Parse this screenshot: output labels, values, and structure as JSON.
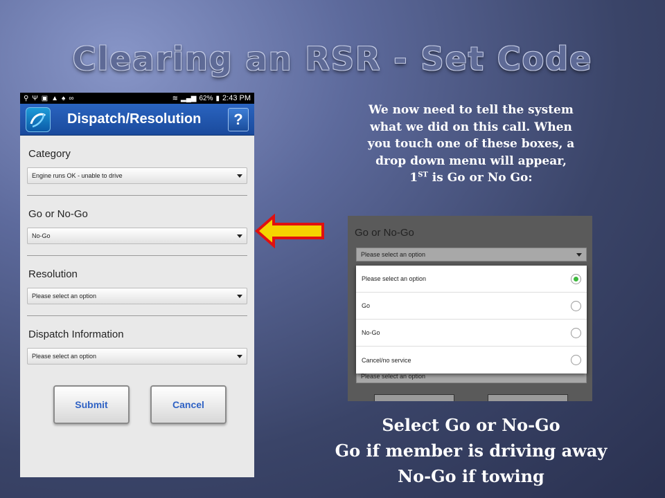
{
  "slide": {
    "title": "Clearing an RSR - Set Code"
  },
  "phone": {
    "status_bar": {
      "battery": "62%",
      "time": "2:43 PM"
    },
    "app_bar": {
      "title": "Dispatch/Resolution",
      "help_label": "?"
    },
    "fields": [
      {
        "label": "Category",
        "value": "Engine runs OK - unable to drive"
      },
      {
        "label": "Go or No-Go",
        "value": "No-Go"
      },
      {
        "label": "Resolution",
        "value": "Please select an option"
      },
      {
        "label": "Dispatch Information",
        "value": "Please select an option"
      }
    ],
    "buttons": {
      "submit": "Submit",
      "cancel": "Cancel"
    }
  },
  "instructions": {
    "line1": "We now need to tell the system",
    "line2": "what we did on this call. When",
    "line3": "you touch one of these boxes, a",
    "line4": "drop down menu will appear,",
    "line5_num": "1",
    "line5_sup": "ST",
    "line5_rest": " is Go or No Go:"
  },
  "dropdown": {
    "label": "Go or No-Go",
    "select_value": "Please select an option",
    "bottom_select_value": "Please select an option",
    "options": [
      {
        "label": "Please select an option",
        "selected": true
      },
      {
        "label": "Go",
        "selected": false
      },
      {
        "label": "No-Go",
        "selected": false
      },
      {
        "label": "Cancel/no service",
        "selected": false
      }
    ]
  },
  "caption": {
    "line1": "Select Go or No-Go",
    "line2": "Go if member is driving away",
    "line3": "No-Go if towing"
  },
  "colors": {
    "app_bar": "#1a4a9c",
    "button_text": "#2f62c4",
    "arrow_fill": "#f5d400",
    "arrow_outline": "#e01010",
    "radio_selected": "#3db83d"
  }
}
